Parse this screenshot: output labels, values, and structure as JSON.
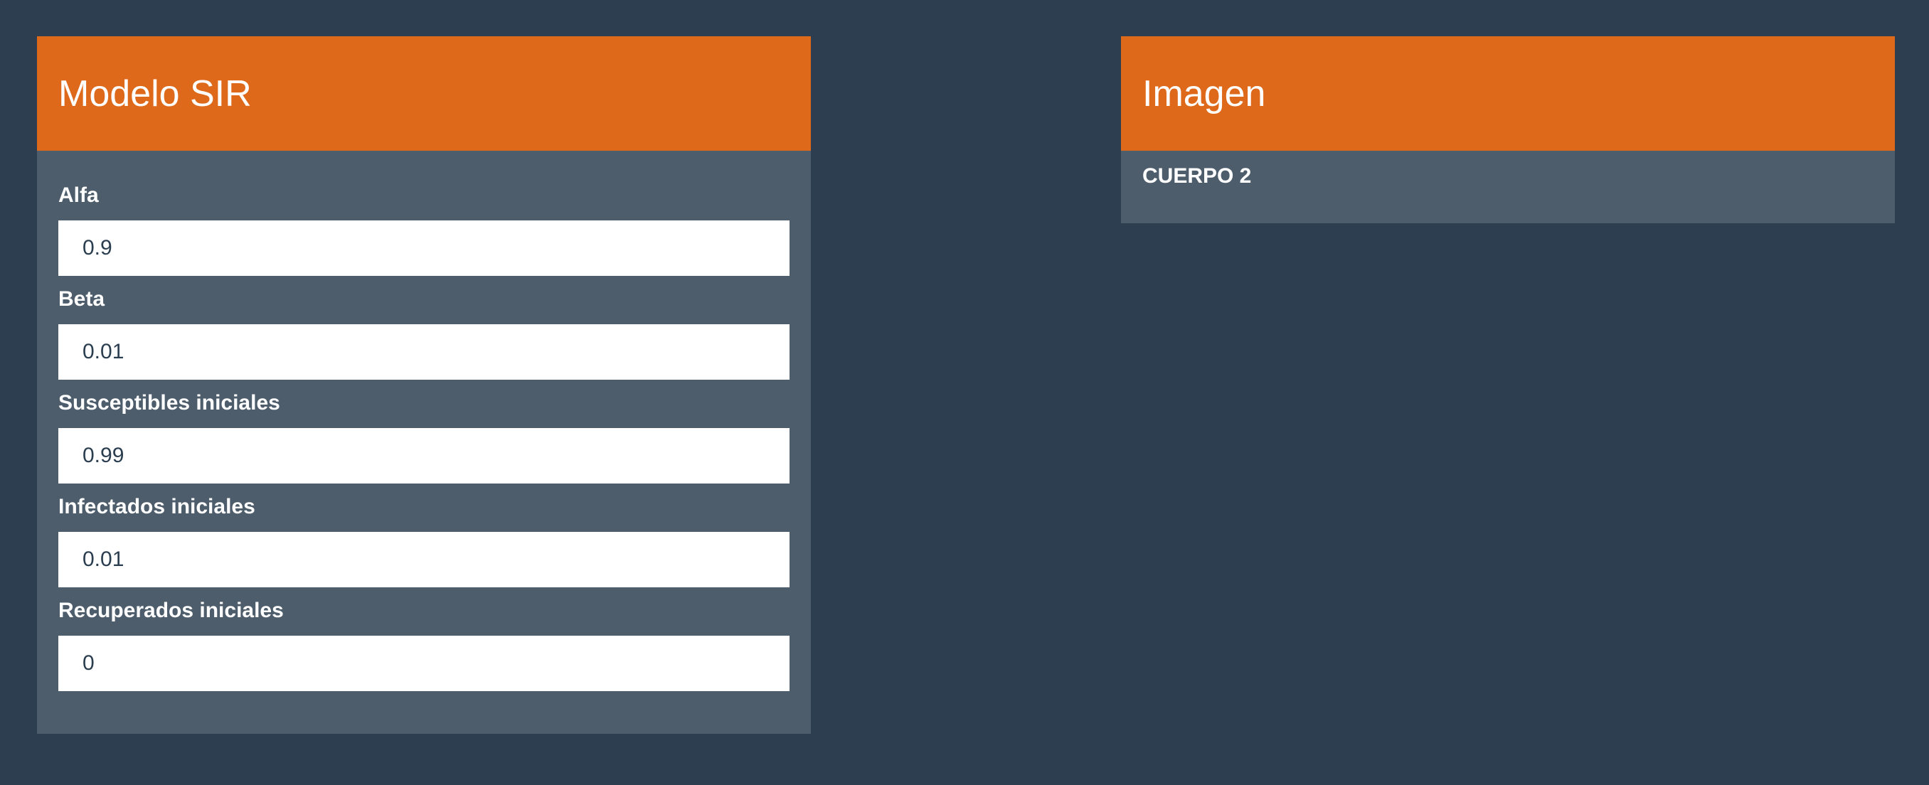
{
  "sir_panel": {
    "title": "Modelo SIR",
    "fields": [
      {
        "label": "Alfa",
        "value": "0.9"
      },
      {
        "label": "Beta",
        "value": "0.01"
      },
      {
        "label": "Susceptibles iniciales",
        "value": "0.99"
      },
      {
        "label": "Infectados iniciales",
        "value": "0.01"
      },
      {
        "label": "Recuperados iniciales",
        "value": "0"
      }
    ]
  },
  "image_panel": {
    "title": "Imagen",
    "body": "CUERPO 2"
  },
  "colors": {
    "background": "#2c3e50",
    "panel_heading": "#df691a",
    "panel_body": "#4e5d6c",
    "input_background": "#ffffff"
  }
}
